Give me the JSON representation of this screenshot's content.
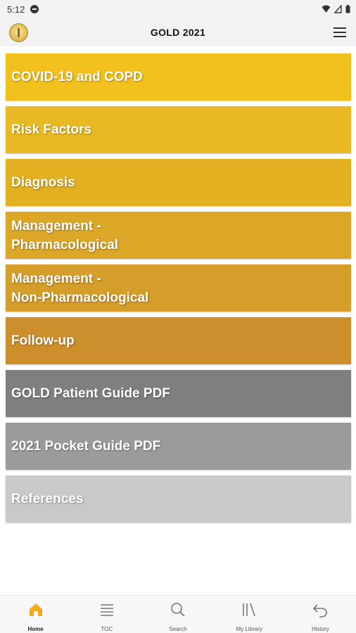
{
  "status": {
    "time": "5:12"
  },
  "app_bar": {
    "title": "GOLD 2021"
  },
  "menu": [
    {
      "label": "COVID-19 and COPD",
      "color": "#F2C11D"
    },
    {
      "label": "Risk Factors",
      "color": "#E8B922"
    },
    {
      "label": "Diagnosis",
      "color": "#E2B020"
    },
    {
      "label": "Management -\nPharmacological",
      "color": "#DCA727"
    },
    {
      "label": "Management -\nNon-Pharmacological",
      "color": "#D59D29"
    },
    {
      "label": "Follow-up",
      "color": "#CC8F2C"
    },
    {
      "label": "GOLD Patient Guide PDF",
      "color": "#7F7F7F"
    },
    {
      "label": "2021 Pocket Guide PDF",
      "color": "#9B9B9B"
    },
    {
      "label": "References",
      "color": "#C9C9C9"
    }
  ],
  "bottom_nav": [
    {
      "label": "Home",
      "icon": "home-icon",
      "active": true
    },
    {
      "label": "TOC",
      "icon": "list-icon",
      "active": false
    },
    {
      "label": "Search",
      "icon": "search-icon",
      "active": false
    },
    {
      "label": "My Library",
      "icon": "library-icon",
      "active": false
    },
    {
      "label": "History",
      "icon": "undo-icon",
      "active": false
    }
  ],
  "colors": {
    "accent": "#F2A91D"
  }
}
